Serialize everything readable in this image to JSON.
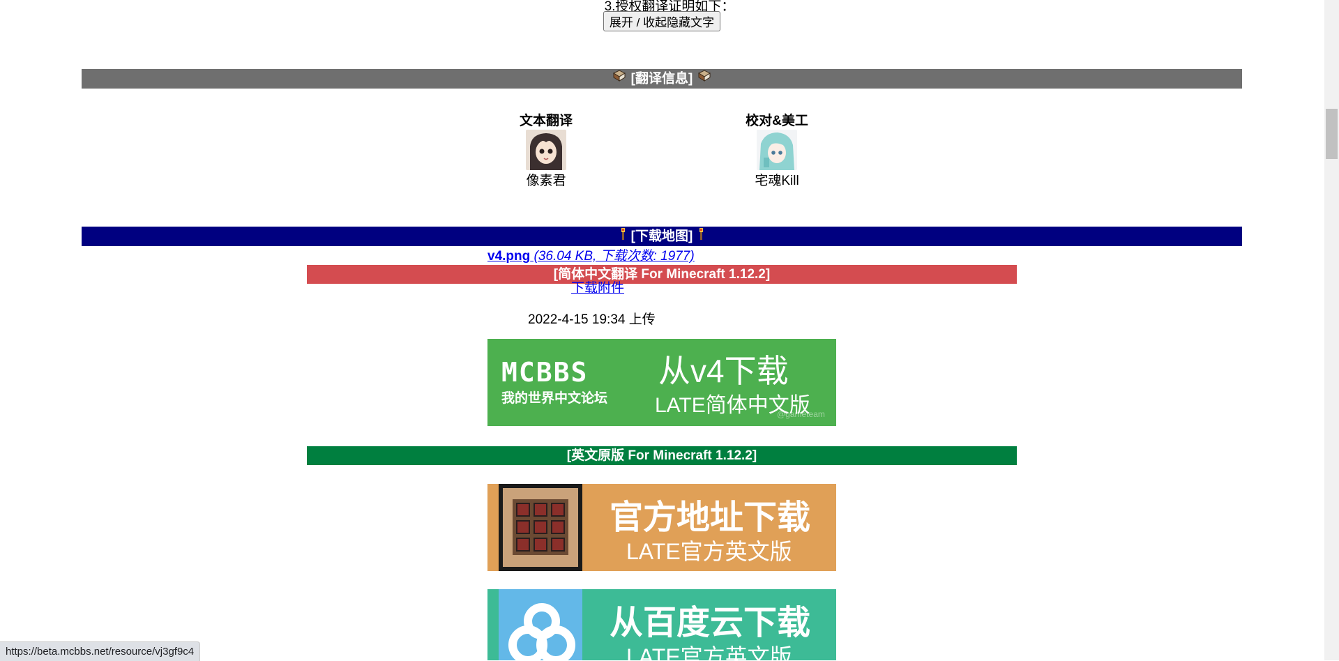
{
  "top": {
    "partial_line": "3.授权翻译证明如下：",
    "toggle_button": "展开 / 收起隐藏文字"
  },
  "translation_section": {
    "title": "[翻译信息]",
    "credits": [
      {
        "role": "文本翻译",
        "name": "像素君"
      },
      {
        "role": "校对&美工",
        "name": "宅魂Kill"
      }
    ]
  },
  "download_section": {
    "title": "[下载地图]",
    "attachment": {
      "filename": "v4.png",
      "meta": " (36.04 KB, 下载次数: 1977)",
      "download_link": "下载附件",
      "upload_time": "2022-4-15 19:34 上传"
    },
    "zh_bar": "[简体中文翻译 For Minecraft 1.12.2]",
    "en_bar": "[英文原版 For Minecraft 1.12.2]",
    "banners": {
      "mcbbs": {
        "logo": "MCBBS",
        "logo_sub": "我的世界中文论坛",
        "title": "从v4下载",
        "subtitle": "LATE简体中文版",
        "watermark": "@gameteam"
      },
      "official": {
        "title": "官方地址下载",
        "subtitle": "LATE官方英文版"
      },
      "baidu": {
        "title": "从百度云下载",
        "subtitle": "LATE官方英文版"
      }
    }
  },
  "status_bar": {
    "url": "https://beta.mcbbs.net/resource/vj3gf9c4"
  },
  "colors": {
    "gray_bar": "#6f6f6f",
    "navy_bar": "#000080",
    "red_bar": "#d44c50",
    "green_bar": "#007f3f",
    "mcbbs_green": "#4db04f",
    "official_orange": "#e0a057",
    "baidu_teal": "#3dbb96"
  }
}
